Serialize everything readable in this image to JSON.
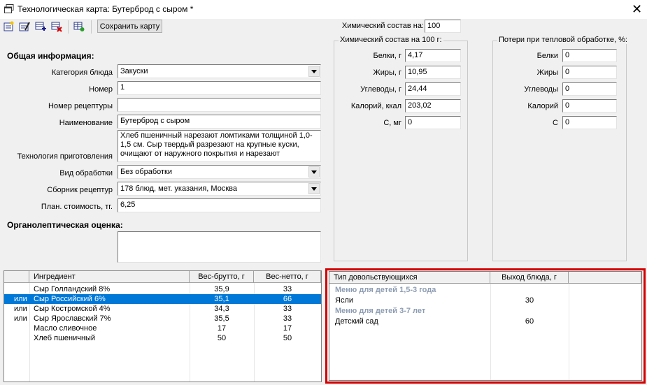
{
  "window": {
    "title": "Технологическая карта: Бутерброд с сыром *",
    "close_glyph": "✕"
  },
  "toolbar": {
    "icons": [
      "new-card-icon",
      "edit-card-icon",
      "add-row-icon",
      "delete-row-icon",
      "add-table-icon"
    ],
    "save_label": "Сохранить карту"
  },
  "chem_basis": {
    "label": "Химический состав на:",
    "value": "100"
  },
  "general": {
    "heading": "Общая информация:",
    "category_label": "Категория блюда",
    "category_value": "Закуски",
    "number_label": "Номер",
    "number_value": "1",
    "recipe_number_label": "Номер рецептуры",
    "recipe_number_value": "",
    "name_label": "Наименование",
    "name_value": "Бутерброд с сыром",
    "technology_label": "Технология приготовления",
    "technology_value": "Хлеб пшеничный нарезают ломтиками толщиной 1,0-1,5 см. Сыр твердый разрезают на крупные куски, очищают от наружного покрытия и нарезают",
    "processing_label": "Вид обработки",
    "processing_value": "Без обработки",
    "collection_label": "Сборник рецептур",
    "collection_value": "178 блюд, мет. указания, Москва",
    "cost_label": "План. стоимость, тг.",
    "cost_value": "6,25",
    "organoleptic_heading": "Органолептическая оценка:",
    "organoleptic_value": ""
  },
  "chem_per100": {
    "title": "Химический состав на 100 г:",
    "rows": [
      {
        "label": "Белки, г",
        "value": "4,17"
      },
      {
        "label": "Жиры, г",
        "value": "10,95"
      },
      {
        "label": "Углеводы, г",
        "value": "24,44"
      },
      {
        "label": "Калорий, ккал",
        "value": "203,02"
      },
      {
        "label": "C, мг",
        "value": "0"
      }
    ]
  },
  "losses": {
    "title": "Потери при тепловой обработке, %:",
    "rows": [
      {
        "label": "Белки",
        "value": "0"
      },
      {
        "label": "Жиры",
        "value": "0"
      },
      {
        "label": "Углеводы",
        "value": "0"
      },
      {
        "label": "Калорий",
        "value": "0"
      },
      {
        "label": "C",
        "value": "0"
      }
    ]
  },
  "ingredients": {
    "headers": [
      "",
      "Ингредиент",
      "Вес-брутто, г",
      "Вес-нетто, г"
    ],
    "rows": [
      {
        "prefix": "",
        "name": "Сыр Голландский 8%",
        "gross": "35,9",
        "net": "33",
        "selected": false
      },
      {
        "prefix": "или",
        "name": "Сыр Российский 6%",
        "gross": "35,1",
        "net": "66",
        "selected": true
      },
      {
        "prefix": "или",
        "name": "Сыр Костромской 4%",
        "gross": "34,3",
        "net": "33",
        "selected": false
      },
      {
        "prefix": "или",
        "name": "Сыр Ярославский 7%",
        "gross": "35,5",
        "net": "33",
        "selected": false
      },
      {
        "prefix": "",
        "name": "Масло сливочное",
        "gross": "17",
        "net": "17",
        "selected": false
      },
      {
        "prefix": "",
        "name": "Хлеб пшеничный",
        "gross": "50",
        "net": "50",
        "selected": false
      }
    ]
  },
  "servings": {
    "headers": [
      "Тип довольствующихся",
      "Выход блюда, г"
    ],
    "rows": [
      {
        "type": "category",
        "label": "Меню для детей 1,5-3 года",
        "value": ""
      },
      {
        "type": "item",
        "label": "Ясли",
        "value": "30"
      },
      {
        "type": "category",
        "label": "Меню для детей 3-7 лет",
        "value": ""
      },
      {
        "type": "item",
        "label": "Детский сад",
        "value": "60"
      }
    ]
  },
  "colors": {
    "selection": "#0078d7",
    "highlight_frame": "#d40000",
    "category_text": "#8e9db3"
  }
}
